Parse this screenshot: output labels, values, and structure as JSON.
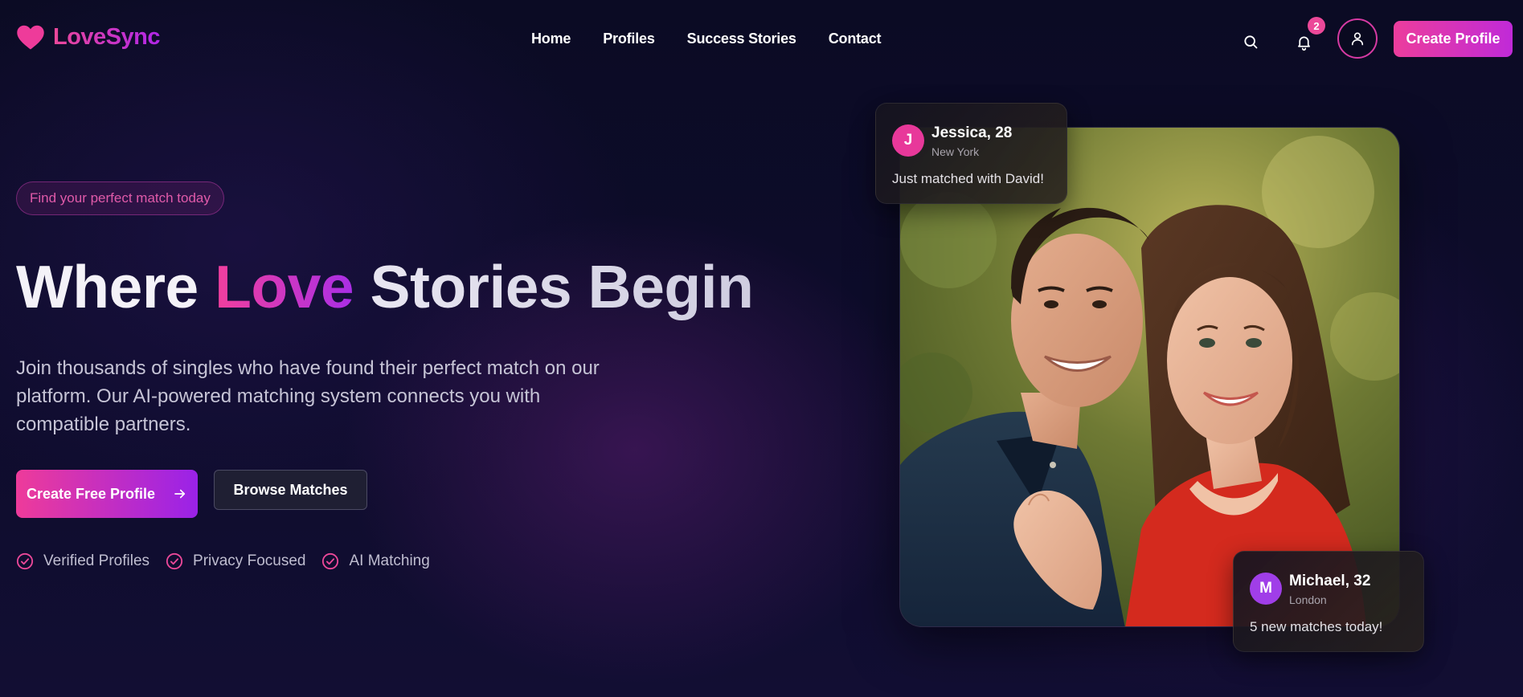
{
  "brand": {
    "name": "LoveSync",
    "logo_icon": "heart-icon",
    "accent": "#ec4899",
    "accent_secondary": "#a855f7"
  },
  "nav": {
    "items": [
      {
        "label": "Home"
      },
      {
        "label": "Profiles"
      },
      {
        "label": "Success Stories"
      },
      {
        "label": "Contact"
      }
    ]
  },
  "header": {
    "search_icon": "search-icon",
    "bell_icon": "bell-icon",
    "notification_count": "2",
    "user_icon": "user-icon",
    "create_profile_label": "Create Profile"
  },
  "hero": {
    "pill": "Find your perfect match today",
    "title_part1": "Where ",
    "title_part2": "Love",
    "title_part3": " Stories Begin",
    "description": "Join thousands of singles who have found their perfect match on our platform. Our AI-powered matching system connects you with compatible partners.",
    "primary_cta": "Create Free Profile",
    "primary_cta_icon": "arrow-right-icon",
    "secondary_cta": "Browse Matches",
    "features": [
      {
        "label": "Verified Profiles",
        "icon": "check-circle-icon"
      },
      {
        "label": "Privacy Focused",
        "icon": "check-circle-icon"
      },
      {
        "label": "AI Matching",
        "icon": "check-circle-icon"
      }
    ]
  },
  "cards": [
    {
      "initial": "J",
      "name": "Jessica, 28",
      "location": "New York",
      "message": "Just matched with David!"
    },
    {
      "initial": "M",
      "name": "Michael, 32",
      "location": "London",
      "message": "5 new matches today!"
    }
  ]
}
